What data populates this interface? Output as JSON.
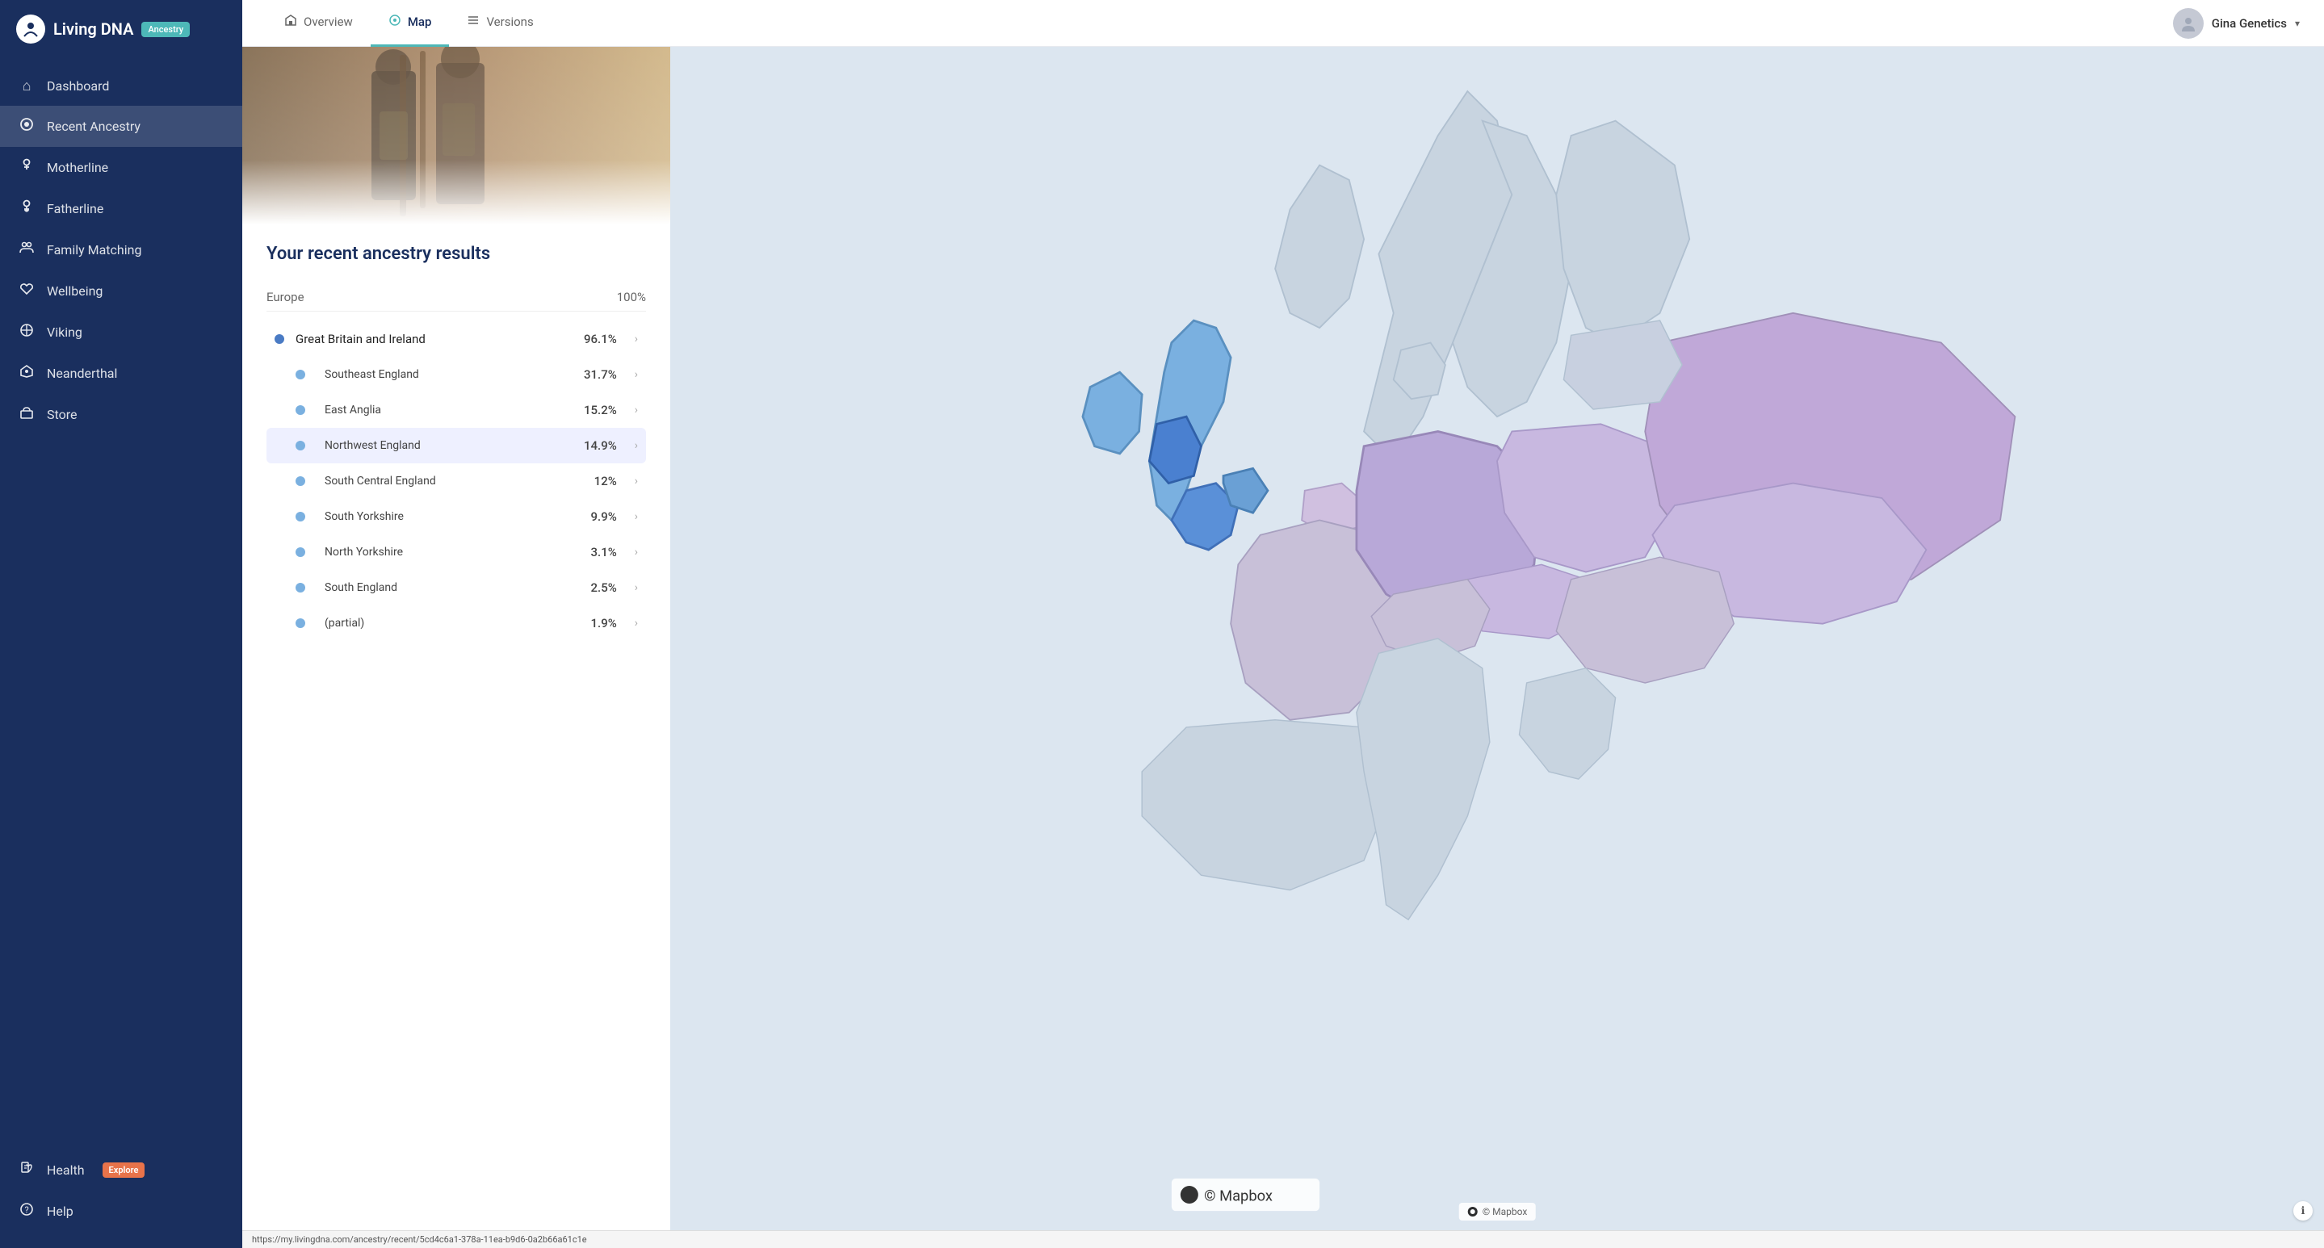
{
  "app": {
    "name": "Living DNA",
    "badge": "Ancestry"
  },
  "sidebar": {
    "items": [
      {
        "id": "dashboard",
        "label": "Dashboard",
        "icon": "⌂"
      },
      {
        "id": "recent-ancestry",
        "label": "Recent Ancestry",
        "icon": "◎",
        "active": true
      },
      {
        "id": "motherline",
        "label": "Motherline",
        "icon": "♀"
      },
      {
        "id": "fatherline",
        "label": "Fatherline",
        "icon": "♂"
      },
      {
        "id": "family-matching",
        "label": "Family Matching",
        "icon": "👥"
      },
      {
        "id": "wellbeing",
        "label": "Wellbeing",
        "icon": "♡"
      },
      {
        "id": "viking",
        "label": "Viking",
        "icon": "⊕"
      },
      {
        "id": "neanderthal",
        "label": "Neanderthal",
        "icon": "✦"
      },
      {
        "id": "store",
        "label": "Store",
        "icon": "🛒"
      }
    ],
    "bottom_items": [
      {
        "id": "health",
        "label": "Health",
        "icon": "⏳",
        "badge": "Explore"
      },
      {
        "id": "help",
        "label": "Help",
        "icon": "?"
      }
    ]
  },
  "topnav": {
    "tabs": [
      {
        "id": "overview",
        "label": "Overview",
        "icon": "⌂",
        "active": false
      },
      {
        "id": "map",
        "label": "Map",
        "icon": "◎",
        "active": true
      },
      {
        "id": "versions",
        "label": "Versions",
        "icon": "☰",
        "active": false
      }
    ],
    "user": {
      "name": "Gina Genetics"
    }
  },
  "results": {
    "title": "Your recent ancestry results",
    "region_label": "Europe",
    "region_pct": "100%",
    "main_group": {
      "label": "Great Britain and Ireland",
      "pct": "96.1%"
    },
    "sub_items": [
      {
        "label": "Southeast England",
        "pct": "31.7%",
        "highlighted": false
      },
      {
        "label": "East Anglia",
        "pct": "15.2%",
        "highlighted": false
      },
      {
        "label": "Northwest England",
        "pct": "14.9%",
        "highlighted": true
      },
      {
        "label": "South Central England",
        "pct": "12%",
        "highlighted": false
      },
      {
        "label": "South Yorkshire",
        "pct": "9.9%",
        "highlighted": false
      },
      {
        "label": "North Yorkshire",
        "pct": "3.1%",
        "highlighted": false
      },
      {
        "label": "South England",
        "pct": "2.5%",
        "highlighted": false
      },
      {
        "label": "(partial)",
        "pct": "1.9%",
        "highlighted": false
      }
    ]
  },
  "mapbox": {
    "logo": "© Mapbox"
  },
  "url_bar": "https://my.livingdna.com/ancestry/recent/5cd4c6a1-378a-11ea-b9d6-0a2b66a61c1e"
}
